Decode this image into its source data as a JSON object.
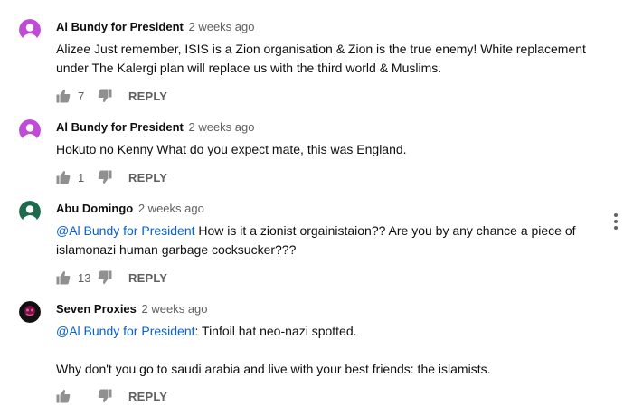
{
  "comments": [
    {
      "author": "Al Bundy for President",
      "time": "2 weeks ago",
      "body": "Alizee Just remember, ISIS is a Zion organisation & Zion is the true enemy! White replacement under The Kalergi plan will replace us with the third world & Muslims.",
      "likes": "7",
      "reply": "REPLY",
      "avatar_color": "#c04bd6"
    },
    {
      "author": "Al Bundy for President",
      "time": "2 weeks ago",
      "body": "Hokuto no Kenny What do you expect mate, this was England.",
      "likes": "1",
      "reply": "REPLY",
      "avatar_color": "#c04bd6"
    },
    {
      "author": "Abu Domingo",
      "time": "2 weeks ago",
      "mention": "@Al Bundy for President",
      "body": " How is it a zionist orgainistaion?? Are you by any chance a piece of islamonazi human garbage cocksucker???",
      "likes": "13",
      "reply": "REPLY",
      "avatar_color": "#1d6a4f"
    },
    {
      "author": "Seven Proxies",
      "time": "2 weeks ago",
      "mention": "@Al Bundy for President",
      "body": ": Tinfoil hat neo-nazi spotted.",
      "body2": "Why don't you go to saudi arabia and live with your best friends: the islamists.",
      "reply": "REPLY",
      "avatar_color": "#111111"
    }
  ],
  "icons": {
    "like": "thumbs-up-icon",
    "dislike": "thumbs-down-icon",
    "menu": "more-vert-icon"
  }
}
